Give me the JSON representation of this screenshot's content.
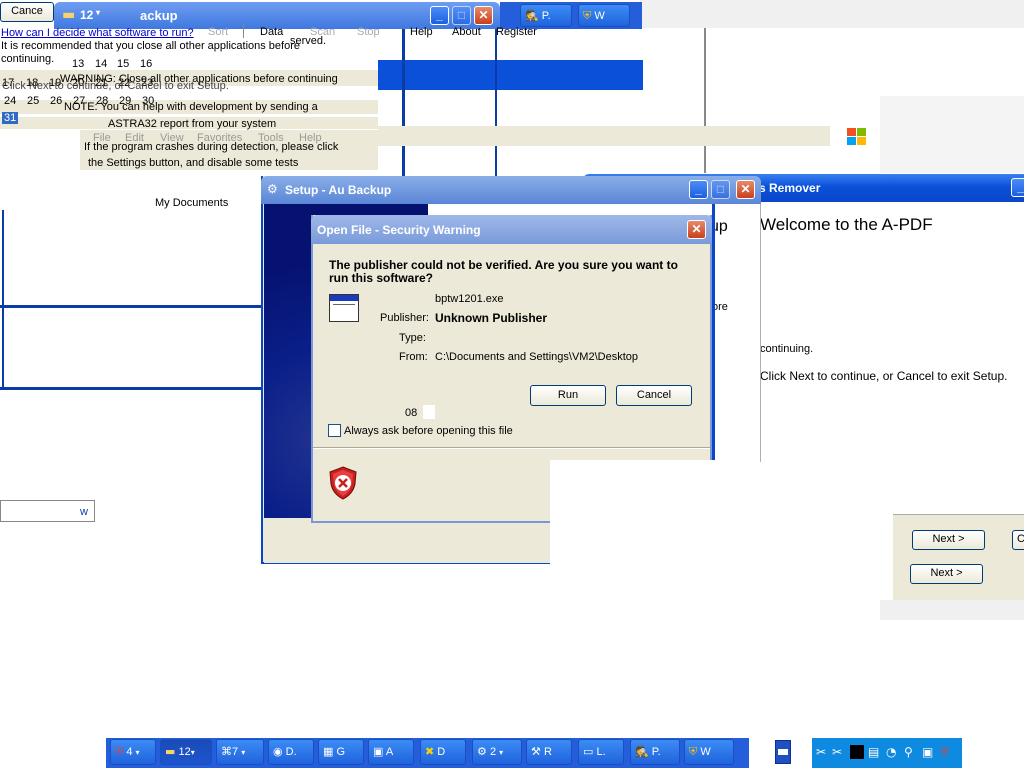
{
  "bg_setup": {
    "cancel_label": "Cance",
    "help_link": "How can I decide what software to run?",
    "recommend_text": "It is recommended that you close all other applications before continuing.",
    "warning_text": "WARNING: Close all other applications before continuing",
    "click_text": "Click Next to continue, or Cancel to exit Setup.",
    "note_text": "NOTE: You can help with development by sending a",
    "astra_text": "ASTRA32 report from your system",
    "crash_text": "If the program crashes during detection, please click",
    "settings_text": "the Settings button, and disable some tests",
    "reserved_text": "served.",
    "my_documents": "My Documents",
    "calendar": {
      "row1": [
        "13",
        "14",
        "15",
        "16"
      ],
      "row2": [
        "17",
        "18",
        "19",
        "20",
        "21",
        "22",
        "23"
      ],
      "row3": [
        "24",
        "25",
        "26",
        "27",
        "28",
        "29",
        "30"
      ],
      "row4": [
        "31"
      ]
    },
    "tabs": [
      "Sort",
      "Data",
      "Scan",
      "Stop",
      "Help",
      "About",
      "Register"
    ],
    "menu": [
      "File",
      "Edit",
      "View",
      "Favorites",
      "Tools",
      "Help"
    ],
    "explorer_title": "12",
    "explorer_title_suffix": "ackup",
    "small_w": "w"
  },
  "apdf": {
    "title": "s Remover",
    "welcome": "Welcome to the A-PDF",
    "ore": "ore",
    "continuing": "continuing.",
    "click_next": "Click Next to continue, or Cancel to exit Setup.",
    "up": "up",
    "next1": "Next >",
    "next2": "Next >",
    "c_label": "C"
  },
  "setup": {
    "title": "Setup - Au Backup"
  },
  "dialog": {
    "title": "Open File - Security Warning",
    "question": "The publisher could not be verified.  Are you sure you want to run this software?",
    "filename": "bptw1201.exe",
    "publisher_label": "Publisher:",
    "publisher_value": "Unknown Publisher",
    "type_label": "Type:",
    "type_value": "",
    "from_label": "From:",
    "from_value": "C:\\Documents and Settings\\VM2\\Desktop",
    "run_label": "Run",
    "cancel_label": "Cancel",
    "field_08": "08",
    "checkbox_label": "Always ask before opening this file",
    "checkbox_checked": false
  },
  "top_taskbar": [
    {
      "label": "P.",
      "icon": "spy-icon"
    },
    {
      "label": "W",
      "icon": "shield-icon"
    }
  ],
  "taskbar": {
    "items": [
      {
        "label": "4",
        "icon": "shield-icon"
      },
      {
        "label": "12",
        "icon": "folder-icon"
      },
      {
        "label": "7",
        "icon": "network-icon"
      },
      {
        "label": "D.",
        "icon": "disc-icon"
      },
      {
        "label": "G",
        "icon": "film-icon"
      },
      {
        "label": "A",
        "icon": "app-icon"
      },
      {
        "label": "D",
        "icon": "x-icon"
      },
      {
        "label": "2",
        "icon": "setup-icon"
      },
      {
        "label": "R",
        "icon": "tool-icon"
      },
      {
        "label": "L.",
        "icon": "window-icon"
      },
      {
        "label": "P.",
        "icon": "spy-icon"
      },
      {
        "label": "W",
        "icon": "shield-icon"
      }
    ]
  },
  "colors": {
    "xp_blue": "#0a50d8",
    "dialog_bg": "#ece9d8",
    "taskbar_blue": "#245edb",
    "close_red": "#d4522c",
    "dark_navy": "#0a1f8a"
  }
}
